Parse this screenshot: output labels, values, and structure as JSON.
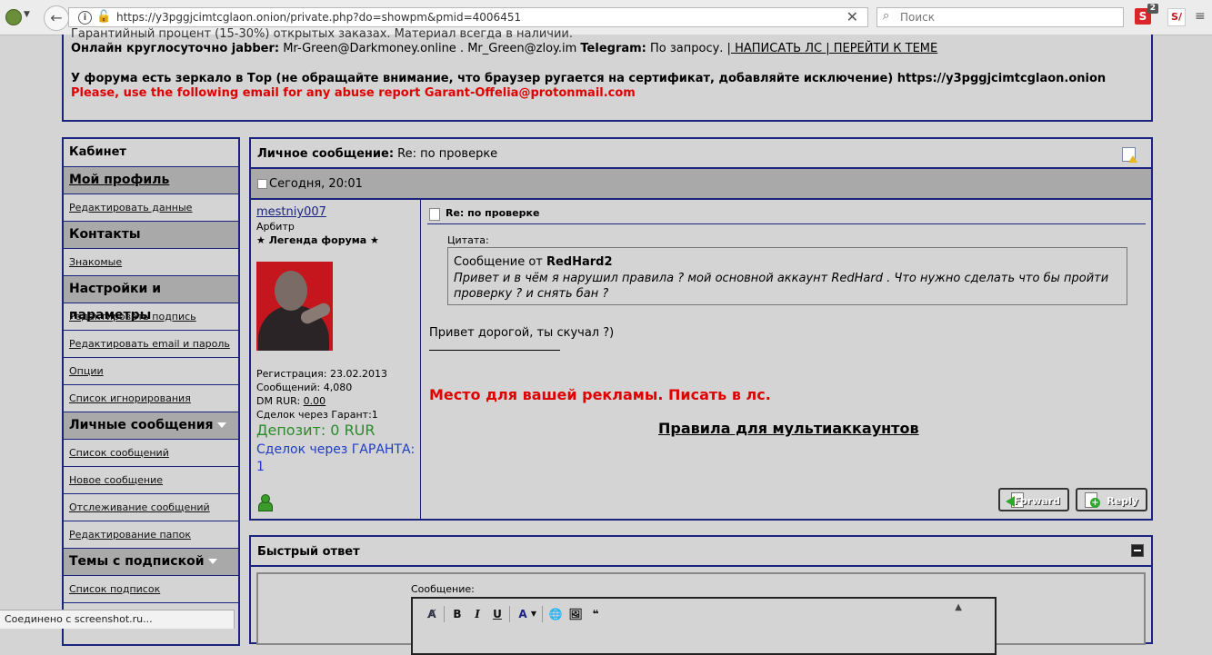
{
  "browser": {
    "url": "https://y3pggjcimtcglaon.onion/private.php?do=showpm&pmid=4006451",
    "search_placeholder": "Поиск",
    "ext_badge": "2",
    "ext1_label": "S",
    "ext2_label": "S/",
    "status": "Соединено с screenshot.ru..."
  },
  "header": {
    "cut_line": "Гарантийный процент (15-30%) открытых заказах. Материал всегда в наличии.",
    "jabber_label": "Онлайн круглосуточно jabber:",
    "jabber_contacts": " Mr-Green@Darkmoney.online . Mr_Green@zloy.im ",
    "telegram_label": "Telegram:",
    "telegram_value": " По запросу. |",
    "links": " НАПИСАТЬ ЛС | ПЕРЕЙТИ К ТЕМЕ",
    "mirror": "У форума есть зеркало в Тор (не обращайте внимание, что браузер ругается на сертификат, добавляйте исключение) https://y3pggjcimtcglaon.onion",
    "abuse": "Please, use the following email for any abuse report Garant-Offelia@protonmail.com"
  },
  "sidebar": {
    "title": "Кабинет",
    "profile": "Мой профиль",
    "edit_data": "Редактировать данные",
    "contacts": "Контакты",
    "friends": "Знакомые",
    "settings": "Настройки и параметры",
    "edit_sig": "Редактировать подпись",
    "edit_email": "Редактировать email и пароль",
    "options": "Опции",
    "ignore": "Список игнорирования",
    "pm": "Личные сообщения",
    "msg_list": "Список сообщений",
    "new_msg": "Новое сообщение",
    "track": "Отслеживание сообщений",
    "folders": "Редактирование папок",
    "subs": "Темы с подпиской",
    "sub_list": "Список подписок"
  },
  "message": {
    "title_label": "Личное сообщение:",
    "title_value": " Re: по проверке",
    "date": "Сегодня, 20:01",
    "username": "mestniy007",
    "role": "Арбитр",
    "rank": "★ Легенда форума ★",
    "reg": "Регистрация: 23.02.2013",
    "posts": "Сообщений: 4,080",
    "dm_label": "DM RUR: ",
    "dm_value": "0.00",
    "deals_garant": "Сделок через Гарант:1",
    "deposit": "Депозит: 0 RUR",
    "deals_caps": "Сделок через ГАРАНТА: 1",
    "subject": "Re: по проверке",
    "quote_label": "Цитата:",
    "quote_from_prefix": "Сообщение от ",
    "quote_author": "RedHard2",
    "quote_text": "Привет и в чём я нарушил правила ? мой основной аккаунт RedHard . Что нужно сделать что бы пройти проверку ? и снять бан ?",
    "reply": "Привет дорогой, ты скучал ?)",
    "ad": "Место для вашей рекламы. Писать в лс.",
    "rules": "Правила для мультиаккаунтов",
    "forward": "Forward",
    "reply_btn": "Reply"
  },
  "quick_reply": {
    "title": "Быстрый ответ",
    "msg_label": "Сообщение:",
    "bold": "B",
    "italic": "I",
    "underline": "U",
    "color": "A"
  }
}
